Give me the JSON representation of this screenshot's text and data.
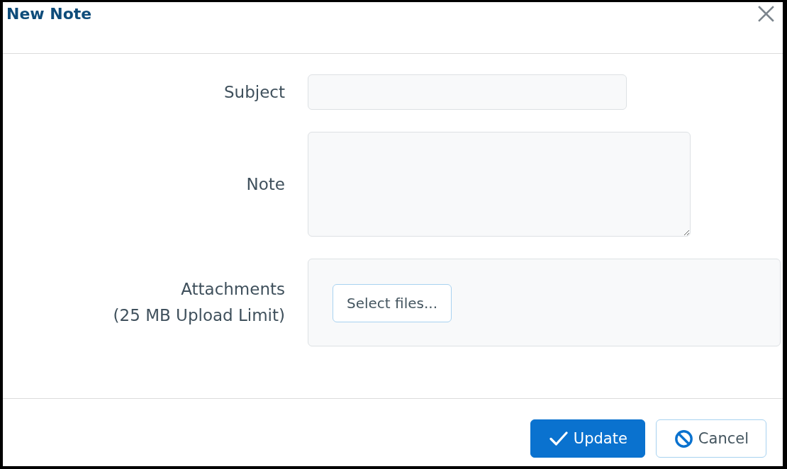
{
  "dialog": {
    "title": "New Note"
  },
  "form": {
    "fields": [
      {
        "kind": "text",
        "label": "Subject"
      },
      {
        "kind": "textarea",
        "label": "Note"
      },
      {
        "kind": "upload",
        "label": "Attachments",
        "hint": "(25 MB Upload Limit)",
        "button": "Select files..."
      }
    ]
  },
  "footer": {
    "buttons": [
      {
        "kind": "primary",
        "label": "Update"
      },
      {
        "kind": "secondary",
        "label": "Cancel"
      }
    ]
  }
}
